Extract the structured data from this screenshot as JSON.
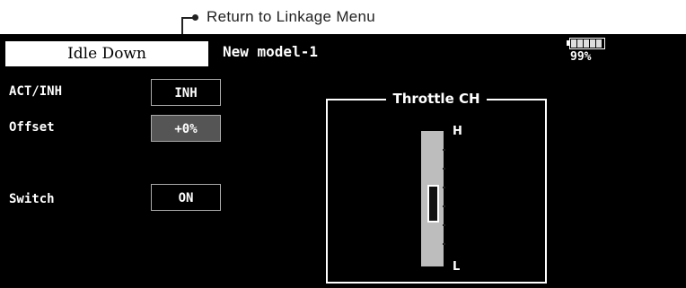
{
  "annotation": {
    "text": "Return to Linkage Menu"
  },
  "header": {
    "title": "Idle Down",
    "model_name": "New model-1",
    "battery_percent": "99%",
    "battery_level": 0.99
  },
  "settings": {
    "act_inh": {
      "label": "ACT/INH",
      "value": "INH"
    },
    "offset": {
      "label": "Offset",
      "value": "+0%"
    },
    "switch": {
      "label": "Switch",
      "value": "ON"
    }
  },
  "throttle": {
    "title": "Throttle CH",
    "high_label": "H",
    "low_label": "L",
    "position_fraction_from_top": 0.55
  },
  "colors": {
    "screen_bg": "#000000",
    "text": "#ffffff",
    "gauge_track": "#bdbdbd",
    "offset_button_bg": "#555555"
  }
}
